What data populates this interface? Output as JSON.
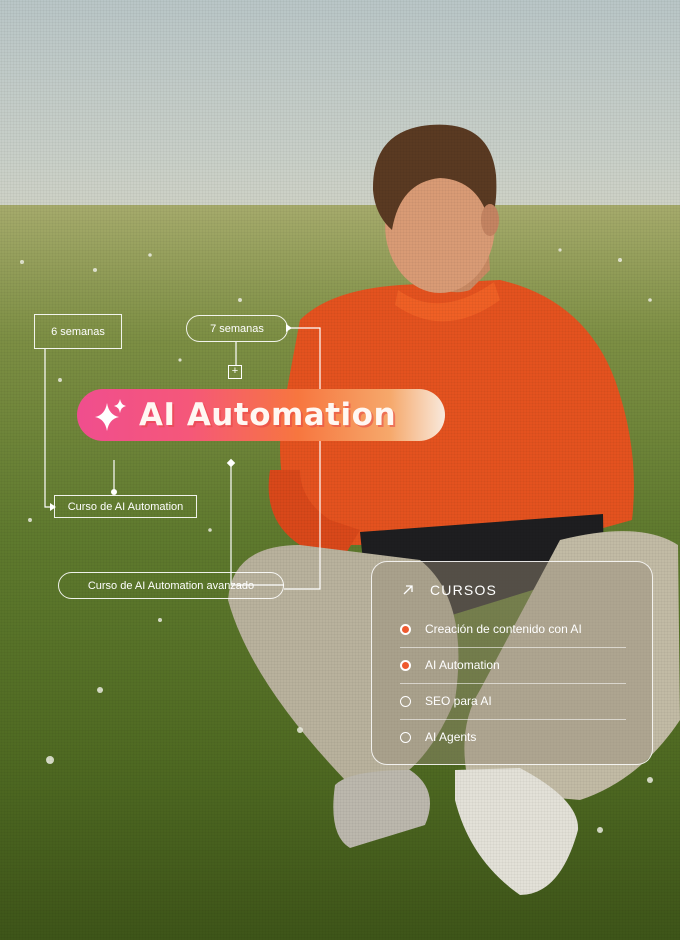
{
  "timeline": {
    "duration_short": "6 semanas",
    "duration_long": "7 semanas",
    "course_basic": "Curso de AI Automation",
    "course_advanced": "Curso de AI Automation avanzado",
    "expand_symbol": "+"
  },
  "brand": {
    "title": "AI Automation",
    "icon": "sparkle-icon"
  },
  "courses_card": {
    "heading": "CURSOS",
    "heading_icon": "arrow-up-right-icon",
    "items": [
      {
        "label": "Creación de contenido con AI",
        "selected": true
      },
      {
        "label": "AI Automation",
        "selected": true
      },
      {
        "label": "SEO para AI",
        "selected": false
      },
      {
        "label": "AI Agents",
        "selected": false
      }
    ]
  },
  "colors": {
    "accent_orange": "#ef5a2f",
    "gradient_pink": "#f04e8e",
    "gradient_orange": "#f7763f"
  }
}
